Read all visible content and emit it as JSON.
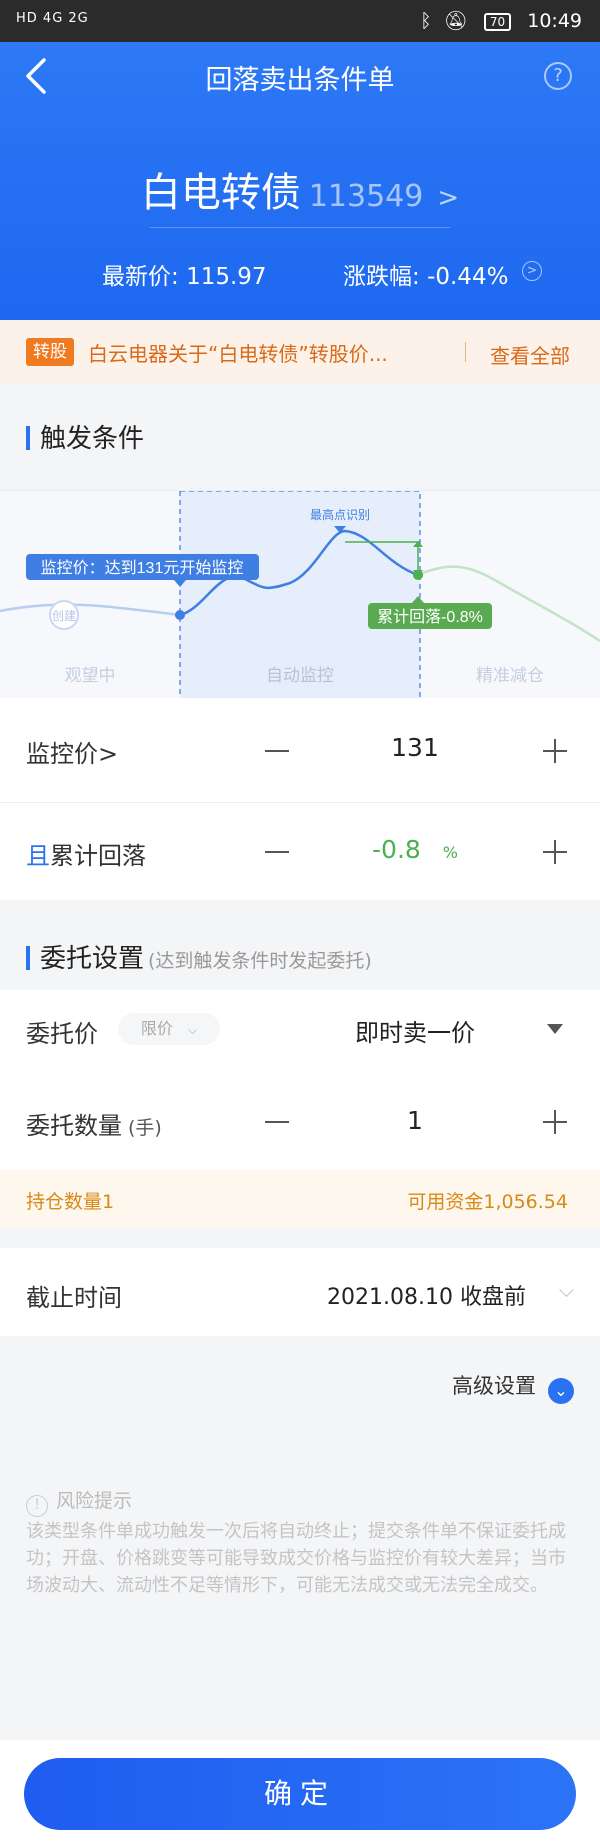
{
  "status_bar": {
    "left": "HD 4G 2G",
    "battery": "70",
    "time": "10:49"
  },
  "header": {
    "title": "回落卖出条件单",
    "help_icon": "question-icon"
  },
  "bond": {
    "name": "白电转债",
    "code": "113549"
  },
  "quote": {
    "price_label": "最新价:",
    "price": "115.97",
    "change_label": "涨跌幅:",
    "change": "-0.44%"
  },
  "notice": {
    "tag": "转股",
    "text": "白云电器关于“白电转债”转股价...",
    "link": "查看全部"
  },
  "trigger_section": {
    "title": "触发条件"
  },
  "chart_labels": {
    "peak": "最高点识别",
    "monitor_callout": "监控价：达到131元开始监控",
    "create": "创建",
    "drop_callout": "累计回落-0.8%",
    "phase_watch": "观望中",
    "phase_auto": "自动监控",
    "phase_reduce": "精准减仓"
  },
  "monitor_price": {
    "label": "监控价>",
    "value": "131"
  },
  "cumulative_drop": {
    "prefix": "且",
    "label": "累计回落",
    "value": "-0.8",
    "unit": "%"
  },
  "order_section": {
    "title": "委托设置",
    "subtitle": "(达到触发条件时发起委托)"
  },
  "order_price": {
    "label": "委托价",
    "type_chip": "限价",
    "value": "即时卖一价"
  },
  "order_qty": {
    "label": "委托数量",
    "unit": "(手)",
    "value": "1"
  },
  "holding": {
    "position": "持仓数量1",
    "funds": "可用资金1,056.54"
  },
  "deadline": {
    "label": "截止时间",
    "value": "2021.08.10 收盘前"
  },
  "advanced": {
    "label": "高级设置"
  },
  "risk": {
    "title": "风险提示",
    "text": "该类型条件单成功触发一次后将自动终止；提交条件单不保证委托成功；开盘、价格跳变等可能导致成交价格与监控价有较大差异；当市场波动大、流动性不足等情形下，可能无法成交或无法完全成交。"
  },
  "confirm": {
    "label": "确定"
  },
  "colors": {
    "primary": "#2b72f3",
    "orange": "#f07a1f",
    "green": "#4caf50"
  }
}
